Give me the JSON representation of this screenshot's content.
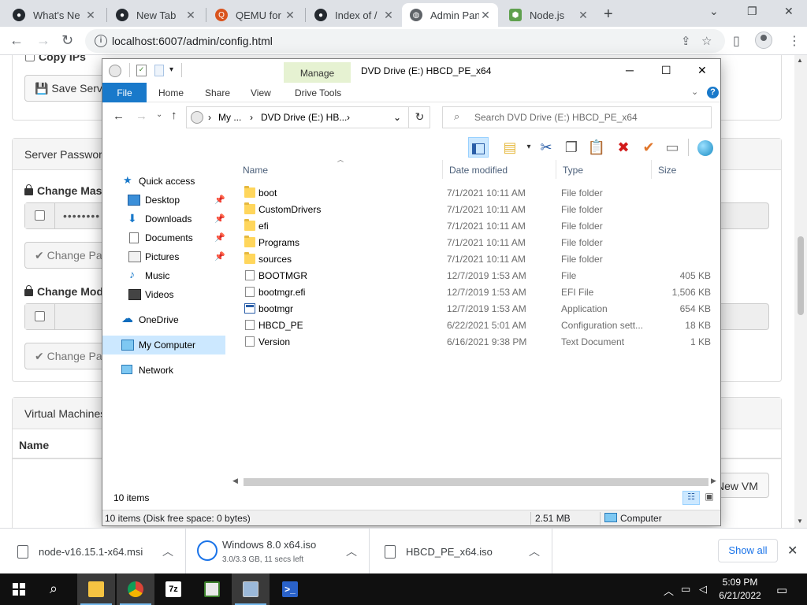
{
  "browser": {
    "tabs": [
      {
        "label": "What's Ne",
        "icon": "github-icon",
        "active": false
      },
      {
        "label": "New Tab",
        "icon": "github-icon",
        "active": false
      },
      {
        "label": "QEMU for",
        "icon": "qemu-icon",
        "active": false
      },
      {
        "label": "Index of /",
        "icon": "github-icon",
        "active": false
      },
      {
        "label": "Admin Pan",
        "icon": "globe-icon",
        "active": true
      },
      {
        "label": "Node.js",
        "icon": "nodejs-icon",
        "active": false
      }
    ],
    "url": "localhost:6007/admin/config.html"
  },
  "admin_page": {
    "copy_ips_label": "Copy IPs",
    "save_server_label": "Save Serve",
    "server_password_heading": "Server Passwor",
    "change_master_label": "Change Mas",
    "master_password_masked": "••••••••",
    "change_password_button_1": "Change Pa",
    "change_mod_label": "Change Mod",
    "change_password_button_2": "Change Pa",
    "virtual_machines_heading": "Virtual Machines",
    "name_column": "Name",
    "new_vm_button": "New VM"
  },
  "explorer": {
    "title": "DVD Drive (E:) HBCD_PE_x64",
    "manage_label": "Manage",
    "ribbon_tabs": [
      "File",
      "Home",
      "Share",
      "View",
      "Drive Tools"
    ],
    "breadcrumb": [
      "My ...",
      "DVD Drive (E:) HB..."
    ],
    "search_placeholder": "Search DVD Drive (E:) HBCD_PE_x64",
    "nav": [
      {
        "label": "Quick access",
        "icon": "star-icon",
        "pinned": false,
        "selected": false
      },
      {
        "label": "Desktop",
        "icon": "desktop-icon",
        "pinned": true,
        "selected": false
      },
      {
        "label": "Downloads",
        "icon": "download-icon",
        "pinned": true,
        "selected": false
      },
      {
        "label": "Documents",
        "icon": "documents-icon",
        "pinned": true,
        "selected": false
      },
      {
        "label": "Pictures",
        "icon": "pictures-icon",
        "pinned": true,
        "selected": false
      },
      {
        "label": "Music",
        "icon": "music-icon",
        "pinned": false,
        "selected": false
      },
      {
        "label": "Videos",
        "icon": "videos-icon",
        "pinned": false,
        "selected": false
      },
      {
        "label": "OneDrive",
        "icon": "cloud-icon",
        "pinned": false,
        "selected": false
      },
      {
        "label": "My Computer",
        "icon": "computer-icon",
        "pinned": false,
        "selected": true
      },
      {
        "label": "Network",
        "icon": "network-icon",
        "pinned": false,
        "selected": false
      }
    ],
    "columns": [
      "Name",
      "Date modified",
      "Type",
      "Size"
    ],
    "files": [
      {
        "name": "boot",
        "date": "7/1/2021 10:11 AM",
        "type": "File folder",
        "size": "",
        "kind": "folder"
      },
      {
        "name": "CustomDrivers",
        "date": "7/1/2021 10:11 AM",
        "type": "File folder",
        "size": "",
        "kind": "folder"
      },
      {
        "name": "efi",
        "date": "7/1/2021 10:11 AM",
        "type": "File folder",
        "size": "",
        "kind": "folder"
      },
      {
        "name": "Programs",
        "date": "7/1/2021 10:11 AM",
        "type": "File folder",
        "size": "",
        "kind": "folder"
      },
      {
        "name": "sources",
        "date": "7/1/2021 10:11 AM",
        "type": "File folder",
        "size": "",
        "kind": "folder"
      },
      {
        "name": "BOOTMGR",
        "date": "12/7/2019 1:53 AM",
        "type": "File",
        "size": "405 KB",
        "kind": "doc"
      },
      {
        "name": "bootmgr.efi",
        "date": "12/7/2019 1:53 AM",
        "type": "EFI File",
        "size": "1,506 KB",
        "kind": "doc"
      },
      {
        "name": "bootmgr",
        "date": "12/7/2019 1:53 AM",
        "type": "Application",
        "size": "654 KB",
        "kind": "app"
      },
      {
        "name": "HBCD_PE",
        "date": "6/22/2021 5:01 AM",
        "type": "Configuration sett...",
        "size": "18 KB",
        "kind": "doc"
      },
      {
        "name": "Version",
        "date": "6/16/2021 9:38 PM",
        "type": "Text Document",
        "size": "1 KB",
        "kind": "doc"
      }
    ],
    "item_count": "10 items",
    "status_left": "10 items (Disk free space: 0 bytes)",
    "status_size": "2.51 MB",
    "status_location": "Computer"
  },
  "downloads": [
    {
      "name": "node-v16.15.1-x64.msi",
      "sub": ""
    },
    {
      "name": "Windows 8.0 x64.iso",
      "sub": "3.0/3.3 GB, 11 secs left"
    },
    {
      "name": "HBCD_PE_x64.iso",
      "sub": ""
    }
  ],
  "show_all_label": "Show all",
  "taskbar": {
    "time": "5:09 PM",
    "date": "6/21/2022"
  }
}
